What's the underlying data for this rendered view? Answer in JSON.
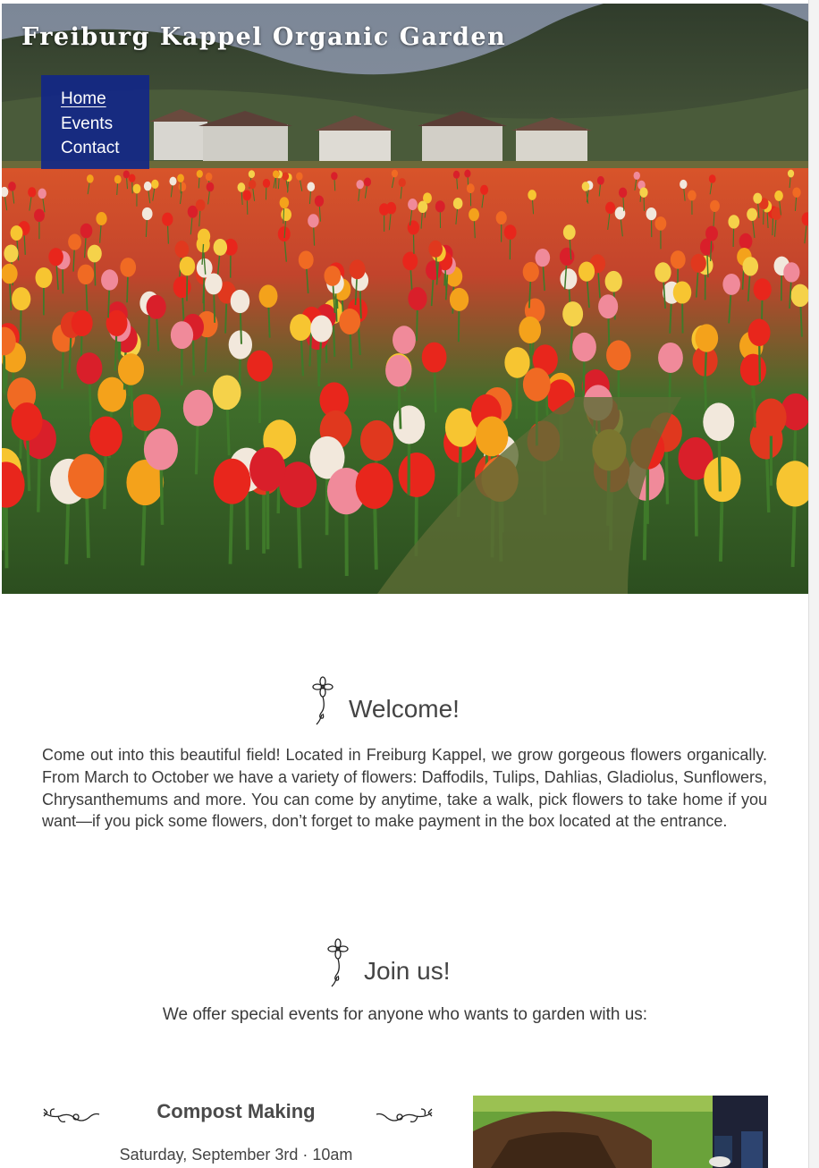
{
  "header": {
    "site_title": "Freiburg Kappel Organic Garden",
    "nav": [
      {
        "label": "Home",
        "active": true
      },
      {
        "label": "Events",
        "active": false
      },
      {
        "label": "Contact",
        "active": false
      }
    ]
  },
  "hero": {
    "icon": "tulip-field-photo"
  },
  "welcome": {
    "title": "Welcome!",
    "icon": "flower-icon",
    "text": "Come out into this beautiful field! Located in Freiburg Kappel, we grow gorgeous flowers organically. From March to October we have a variety of flowers: Daffodils, Tulips, Dahlias, Gladiolus, Sunflowers, Chrysanthemums and more. You can come by anytime, take a walk, pick flowers to take home if you want—if you pick some flowers, don’t forget to make payment in the box located at the entrance."
  },
  "join": {
    "title": "Join us!",
    "icon": "flower-icon",
    "intro": "We offer special events for anyone who wants to garden with us:"
  },
  "events": [
    {
      "title": "Compost Making",
      "date": "Saturday, September 3rd · 10am",
      "photo": "compost-photo"
    }
  ],
  "colors": {
    "nav_bg": "#10248a",
    "text": "#3b3b3b",
    "title_text": "#ffffff"
  }
}
